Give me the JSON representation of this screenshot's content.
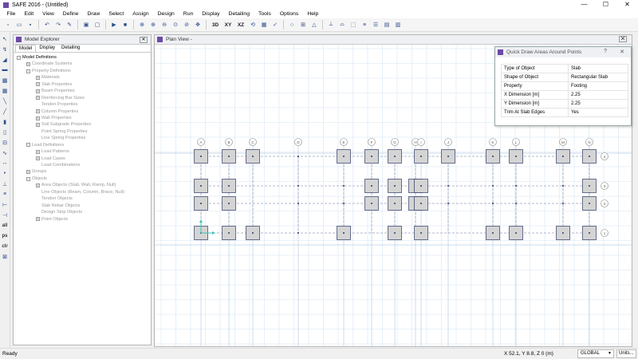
{
  "app": {
    "title": "SAFE 2016 - (Untitled)",
    "icon": "safe-app-icon",
    "accent": "#6b4aa3"
  },
  "window_controls": {
    "minimize": "—",
    "maximize": "☐",
    "close": "✕"
  },
  "menu": [
    "File",
    "Edit",
    "View",
    "Define",
    "Draw",
    "Select",
    "Assign",
    "Design",
    "Run",
    "Display",
    "Detailing",
    "Tools",
    "Options",
    "Help"
  ],
  "toolbar": {
    "icons": [
      "new-icon",
      "open-icon",
      "save-icon",
      "undo-icon",
      "redo-icon",
      "edit-icon",
      "lock-icon",
      "run-icon",
      "stop-icon",
      "refresh-icon",
      "zoom-window-icon",
      "zoom-in-icon",
      "zoom-out-icon",
      "zoom-fit-icon",
      "pan-icon"
    ],
    "view_buttons": [
      "3D",
      "XY",
      "XZ"
    ]
  },
  "model_explorer": {
    "title": "Model Explorer",
    "tabs": [
      "Model",
      "Display",
      "Detailing"
    ],
    "active_tab": "Model",
    "tree": [
      {
        "label": "Model Definitions",
        "level": 0,
        "toggle": "-",
        "root": true
      },
      {
        "label": "Coordinate Systems",
        "level": 1,
        "toggle": "+"
      },
      {
        "label": "Property Definitions",
        "level": 1,
        "toggle": "-"
      },
      {
        "label": "Materials",
        "level": 2,
        "toggle": "+"
      },
      {
        "label": "Slab Properties",
        "level": 2,
        "toggle": "+"
      },
      {
        "label": "Beam Properties",
        "level": 2,
        "toggle": "+"
      },
      {
        "label": "Reinforcing Bar Sizes",
        "level": 2,
        "toggle": "+"
      },
      {
        "label": "Tendon Properties",
        "level": 2,
        "toggle": ""
      },
      {
        "label": "Column Properties",
        "level": 2,
        "toggle": "+"
      },
      {
        "label": "Wall Properties",
        "level": 2,
        "toggle": "+"
      },
      {
        "label": "Soil Subgrade Properties",
        "level": 2,
        "toggle": "+"
      },
      {
        "label": "Point Spring Properties",
        "level": 2,
        "toggle": ""
      },
      {
        "label": "Line Spring Properties",
        "level": 2,
        "toggle": ""
      },
      {
        "label": "Load Definitions",
        "level": 1,
        "toggle": "-"
      },
      {
        "label": "Load Patterns",
        "level": 2,
        "toggle": "+"
      },
      {
        "label": "Load Cases",
        "level": 2,
        "toggle": "+"
      },
      {
        "label": "Load Combinations",
        "level": 2,
        "toggle": ""
      },
      {
        "label": "Groups",
        "level": 1,
        "toggle": "+"
      },
      {
        "label": "Objects",
        "level": 1,
        "toggle": "-"
      },
      {
        "label": "Area Objects (Slab, Wall, Ramp, Null)",
        "level": 2,
        "toggle": "+"
      },
      {
        "label": "Line Objects (Beam, Column, Brace, Null)",
        "level": 2,
        "toggle": ""
      },
      {
        "label": "Tendon Objects",
        "level": 2,
        "toggle": ""
      },
      {
        "label": "Slab Rebar Objects",
        "level": 2,
        "toggle": ""
      },
      {
        "label": "Design Strip Objects",
        "level": 2,
        "toggle": ""
      },
      {
        "label": "Point Objects",
        "level": 2,
        "toggle": "+"
      }
    ]
  },
  "plan_view": {
    "title": "Plan View -",
    "close": "✕"
  },
  "quick_draw": {
    "title": "Quick Draw Areas Around Points",
    "help": "?",
    "close": "✕",
    "rows": [
      {
        "key": "Type of Object",
        "value": "Slab"
      },
      {
        "key": "Shape of Object",
        "value": "Rectangular Slab"
      },
      {
        "key": "Property",
        "value": "Footing"
      },
      {
        "key": "X Dimension  [m]",
        "value": "2.25"
      },
      {
        "key": "Y Dimension  [m]",
        "value": "2.25"
      },
      {
        "key": "Trim At Slab Edges",
        "value": "Yes"
      }
    ]
  },
  "grid": {
    "x_labels": [
      "A",
      "B",
      "C",
      "D",
      "E",
      "F",
      "G",
      "H",
      "I",
      "J",
      "K",
      "L",
      "M",
      "N",
      "O"
    ],
    "y_labels": [
      "4",
      "3",
      "2",
      "1"
    ]
  },
  "status": {
    "ready": "Ready",
    "coords": "X 52.1,  Y 8.8,  Z 0  (m)",
    "coord_system": "GLOBAL",
    "units": "Units..."
  },
  "colors": {
    "grid_line": "#d6e6f3",
    "grid_main": "#99bbd8",
    "footing_fill": "#d4d4d4",
    "footing_edge": "#2f3a64",
    "beam": "#9aa3bd",
    "axis": "#3cc4b4"
  }
}
